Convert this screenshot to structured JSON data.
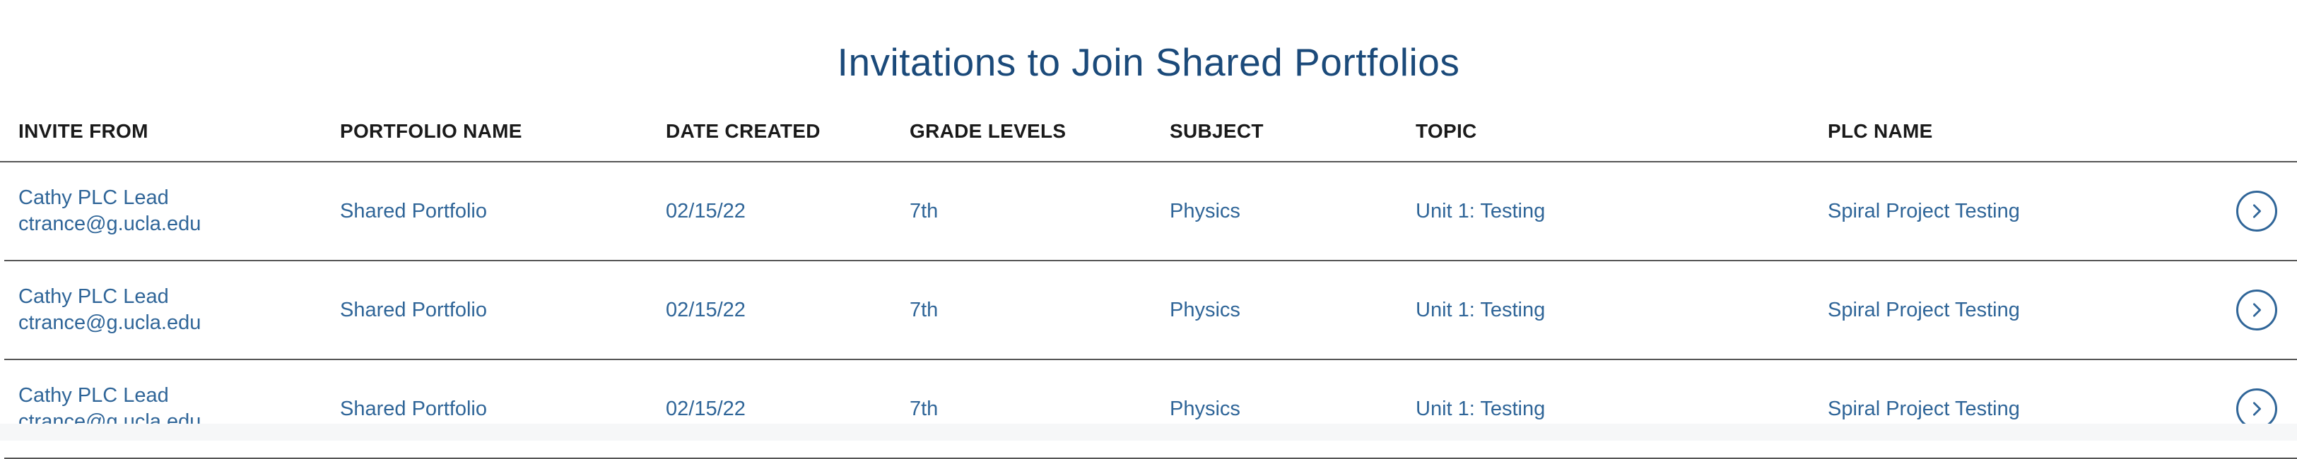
{
  "page": {
    "title": "Invitations to Join Shared Portfolios"
  },
  "table": {
    "headers": {
      "invite_from": "INVITE FROM",
      "portfolio_name": "PORTFOLIO NAME",
      "date_created": "DATE CREATED",
      "grade_levels": "GRADE LEVELS",
      "subject": "SUBJECT",
      "topic": "TOPIC",
      "plc_name": "PLC NAME"
    },
    "rows": [
      {
        "invite_name": "Cathy PLC Lead",
        "invite_email": "ctrance@g.ucla.edu",
        "portfolio_name": "Shared Portfolio",
        "date_created": "02/15/22",
        "grade_levels": "7th",
        "subject": "Physics",
        "topic": "Unit 1: Testing",
        "plc_name": "Spiral Project Testing",
        "action_icon": "chevron-right-circle-icon"
      },
      {
        "invite_name": "Cathy PLC Lead",
        "invite_email": "ctrance@g.ucla.edu",
        "portfolio_name": "Shared Portfolio",
        "date_created": "02/15/22",
        "grade_levels": "7th",
        "subject": "Physics",
        "topic": "Unit 1: Testing",
        "plc_name": "Spiral Project Testing",
        "action_icon": "chevron-right-circle-icon"
      },
      {
        "invite_name": "Cathy PLC Lead",
        "invite_email": "ctrance@g.ucla.edu",
        "portfolio_name": "Shared Portfolio",
        "date_created": "02/15/22",
        "grade_levels": "7th",
        "subject": "Physics",
        "topic": "Unit 1: Testing",
        "plc_name": "Spiral Project Testing",
        "action_icon": "chevron-right-circle-icon"
      }
    ]
  },
  "colors": {
    "title": "#1b4a7a",
    "link": "#2f6598",
    "header_text": "#1a1a1a",
    "divider": "#555555"
  }
}
